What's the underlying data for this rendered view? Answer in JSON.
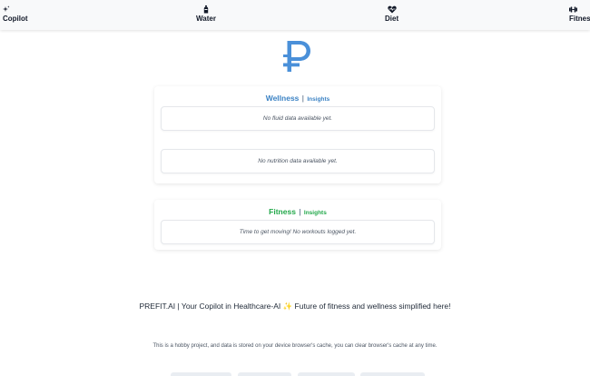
{
  "nav": {
    "items": [
      {
        "label": "Copilot",
        "icon": "sparkle-icon"
      },
      {
        "label": "Water",
        "icon": "bottle-icon"
      },
      {
        "label": "Diet",
        "icon": "heart-pulse-icon"
      },
      {
        "label": "Fitness",
        "icon": "dumbbell-icon"
      }
    ]
  },
  "logo": {
    "icon": "ruble-p-logo",
    "color": "#4a90d9"
  },
  "wellness": {
    "title": "Wellness",
    "separator": "|",
    "subtitle": "Insights",
    "color": "#3b82c4",
    "fluid_empty": "No fluid data available yet.",
    "nutrition_empty": "No nutrition data available yet."
  },
  "fitness": {
    "title": "Fitness",
    "separator": "|",
    "subtitle": "Insights",
    "color": "#22a84a",
    "workout_empty": "Time to get moving! No workouts logged yet."
  },
  "footer": {
    "tagline": "PREFIT.AI | Your Copilot in Healthcare-AI ✨ Future of fitness and wellness simplified here!",
    "disclaimer": "This is a hobby project, and data is stored on your device browser's cache, you can clear browser's cache at any time."
  }
}
